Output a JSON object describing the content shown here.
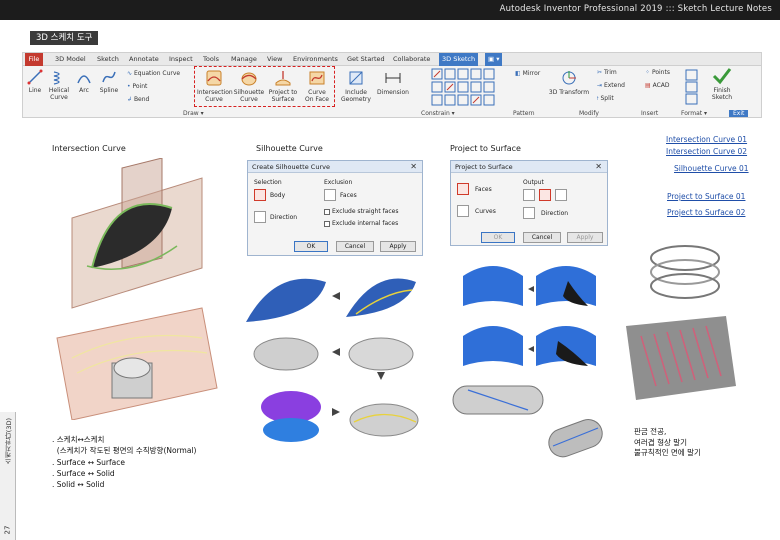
{
  "header": {
    "title": "Autodesk Inventor Professional 2019 ::: Sketch Lecture Notes"
  },
  "badge": "3D 스케치 도구",
  "ribbon": {
    "tabs": [
      "File",
      "3D Model",
      "Sketch",
      "Annotate",
      "Inspect",
      "Tools",
      "Manage",
      "View",
      "Environments",
      "Get Started",
      "Collaborate",
      "3D Sketch",
      "▣ ▾"
    ],
    "draw_tools": [
      {
        "label": "Line"
      },
      {
        "label": "Helical Curve"
      },
      {
        "label": "Arc"
      },
      {
        "label": "Spline"
      }
    ],
    "draw_small": [
      "Equation Curve",
      "Point",
      "Bend"
    ],
    "highlight_tools": [
      {
        "label1": "Intersection",
        "label2": "Curve"
      },
      {
        "label1": "Silhouette",
        "label2": "Curve"
      },
      {
        "label1": "Project to",
        "label2": "Surface"
      },
      {
        "label1": "Curve",
        "label2": "On Face"
      }
    ],
    "include": {
      "label1": "Include",
      "label2": "Geometry"
    },
    "dimension": "Dimension",
    "pattern_small": "Mirror",
    "transform": "3D Transform",
    "modify_small": [
      "Trim",
      "Extend",
      "Split"
    ],
    "insert_small": [
      "Points",
      "ACAD"
    ],
    "finish": {
      "label1": "Finish",
      "label2": "Sketch"
    },
    "panels": [
      "Draw ▾",
      "Constrain ▾",
      "Pattern",
      "Modify",
      "Insert",
      "Format ▾",
      "Exit"
    ]
  },
  "sections": {
    "intersection": "Intersection Curve",
    "silhouette": "Silhouette Curve",
    "project": "Project to Surface"
  },
  "links": [
    "Intersection Curve 01",
    "Intersection Curve 02",
    "Silhouette Curve 01",
    "Project to Surface 01",
    "Project to Surface 02"
  ],
  "dialog_silhouette": {
    "title": "Create Silhouette Curve",
    "selection": "Selection",
    "body": "Body",
    "direction": "Direction",
    "exclusion": "Exclusion",
    "faces": "Faces",
    "excl_straight": "Exclude straight faces",
    "excl_internal": "Exclude internal faces",
    "ok": "OK",
    "cancel": "Cancel",
    "apply": "Apply"
  },
  "dialog_project": {
    "title": "Project to Surface",
    "faces": "Faces",
    "curves": "Curves",
    "output": "Output",
    "direction": "Direction",
    "ok": "OK",
    "cancel": "Cancel",
    "apply": "Apply"
  },
  "bullets": [
    ". 스케치↔스케치",
    "  (스케치가 작도된 평면의 수직방향(Normal)",
    ". Surface ↔ Surface",
    ". Surface ↔ Solid",
    ". Solid ↔ Solid"
  ],
  "right_note": [
    "판금 전공,",
    "여러겹 형상 말기",
    "불규칙적인 면에 말기"
  ],
  "sidebar": {
    "vertical_text": "스케치한다(3D)",
    "page": "27"
  },
  "colors": {
    "accent": "#3f79c5",
    "file_tab": "#c43a2f",
    "highlight": "#d62020",
    "link": "#1f4ea8"
  }
}
